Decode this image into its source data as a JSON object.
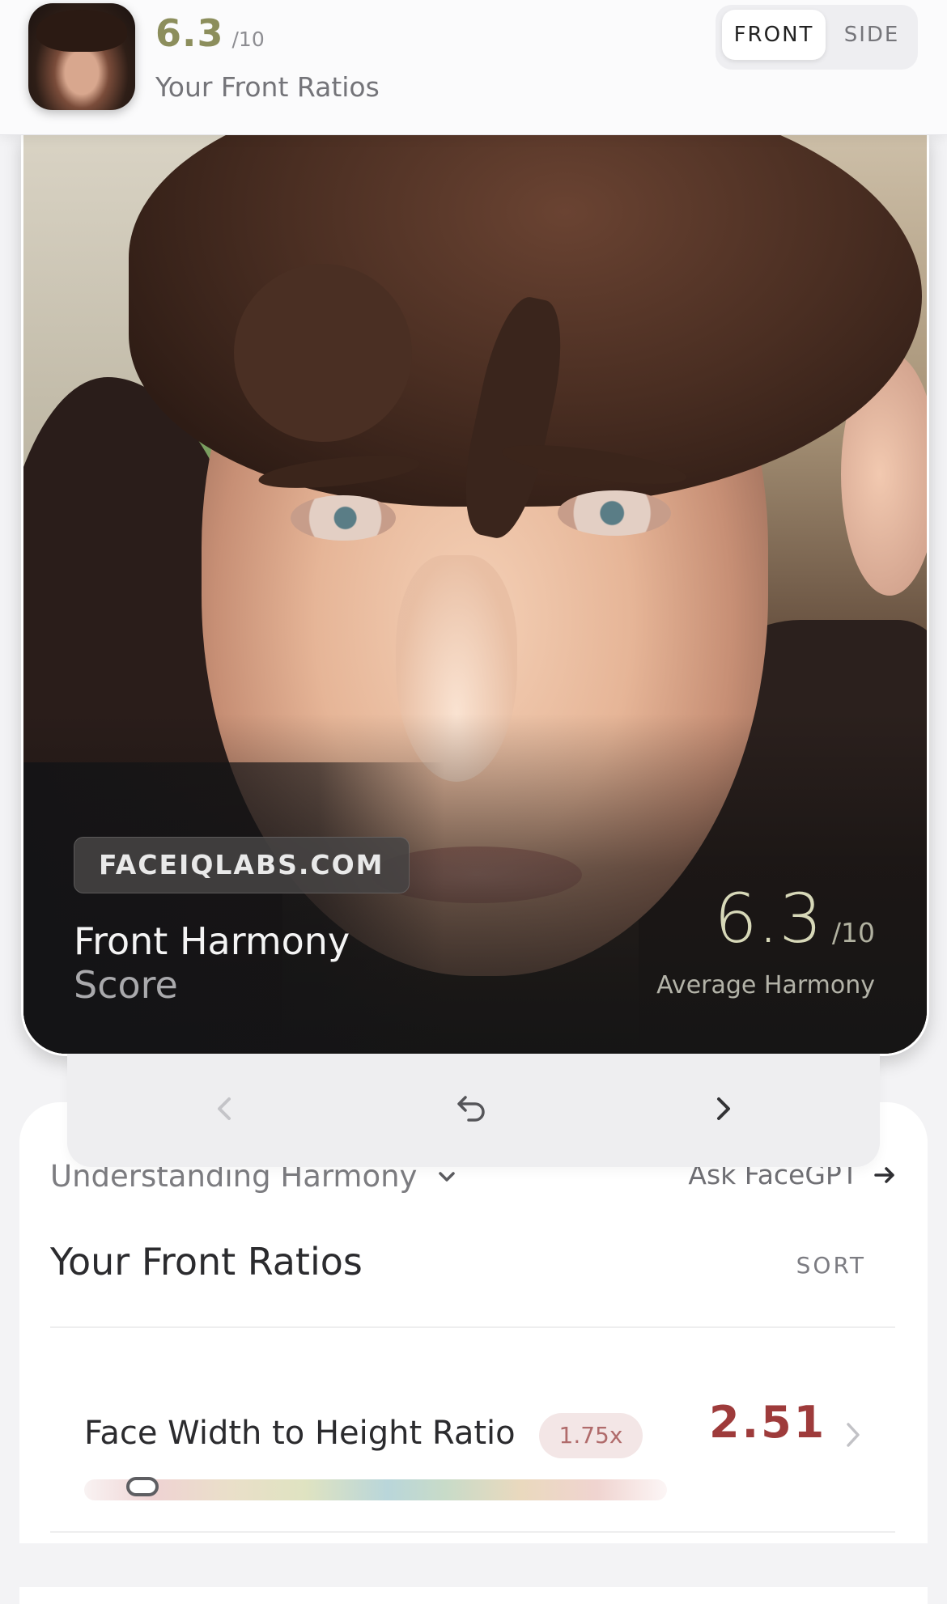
{
  "header": {
    "score": "6.3",
    "score_of": "/10",
    "subtitle": "Your Front Ratios",
    "tabs": [
      {
        "label": "FRONT",
        "active": true
      },
      {
        "label": "SIDE",
        "active": false
      }
    ]
  },
  "photo_card": {
    "watermark": "FACEIQLABS.COM",
    "title_line1": "Front Harmony",
    "title_line2": "Score",
    "score": "6.3",
    "score_of": "/10",
    "rating_label": "Average Harmony"
  },
  "nav": {
    "prev_icon": "chevron-left-icon",
    "reset_icon": "undo-icon",
    "next_icon": "chevron-right-icon"
  },
  "content": {
    "understanding_label": "Understanding Harmony",
    "ask_label": "Ask FaceGPT",
    "section_title": "Your Front Ratios",
    "sort_label": "SORT",
    "ratios": [
      {
        "label": "Face Width to Height Ratio",
        "ideal": "1.75x",
        "value": "2.51",
        "gauge_position": 0.1
      }
    ]
  },
  "colors": {
    "score_olive": "#8c8e5c",
    "value_red": "#9e3b3b",
    "pill_bg": "#f3e6e6"
  }
}
